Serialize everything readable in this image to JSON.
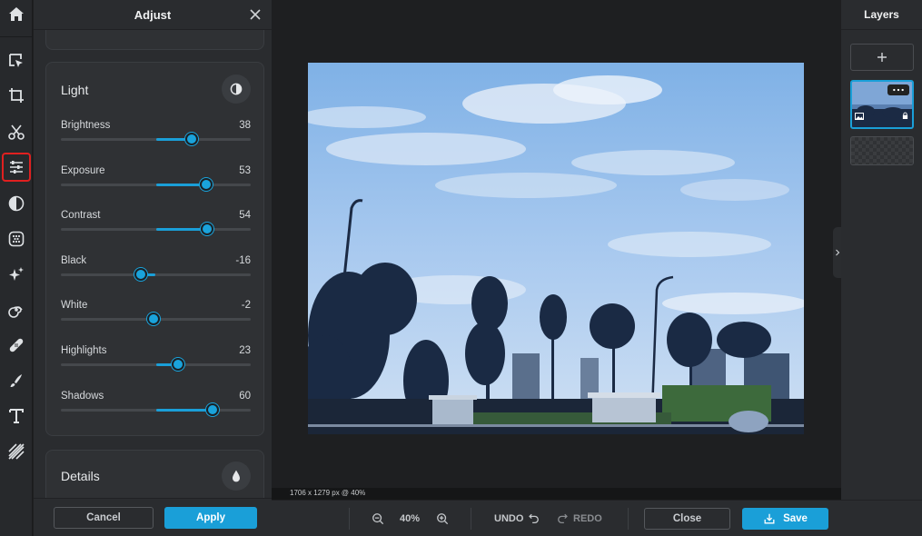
{
  "toolbar": {
    "items": [
      {
        "name": "home-icon"
      },
      {
        "name": "arrange-icon"
      },
      {
        "name": "crop-icon"
      },
      {
        "name": "cutout-icon"
      },
      {
        "name": "adjust-icon",
        "active": true
      },
      {
        "name": "filters-icon"
      },
      {
        "name": "effects-icon"
      },
      {
        "name": "ai-tools-icon"
      },
      {
        "name": "liquify-icon"
      },
      {
        "name": "retouch-icon"
      },
      {
        "name": "draw-icon"
      },
      {
        "name": "text-icon"
      },
      {
        "name": "texture-icon"
      }
    ]
  },
  "adjust": {
    "title": "Adjust",
    "light": {
      "title": "Light",
      "sliders": [
        {
          "label": "Brightness",
          "value": "38",
          "num": 38
        },
        {
          "label": "Exposure",
          "value": "53",
          "num": 53
        },
        {
          "label": "Contrast",
          "value": "54",
          "num": 54
        },
        {
          "label": "Black",
          "value": "-16",
          "num": -16
        },
        {
          "label": "White",
          "value": "-2",
          "num": -2
        },
        {
          "label": "Highlights",
          "value": "23",
          "num": 23
        },
        {
          "label": "Shadows",
          "value": "60",
          "num": 60
        }
      ]
    },
    "details": {
      "title": "Details"
    },
    "cancel_label": "Cancel",
    "apply_label": "Apply"
  },
  "canvas": {
    "image_info": "1706 x 1279 px @ 40%"
  },
  "bottom": {
    "zoom": "40%",
    "undo_label": "UNDO",
    "redo_label": "REDO",
    "close_label": "Close",
    "save_label": "Save"
  },
  "layers": {
    "title": "Layers"
  },
  "colors": {
    "accent": "#1a9fd8",
    "active_outline": "#e02020",
    "panel": "#2a2c2f"
  }
}
